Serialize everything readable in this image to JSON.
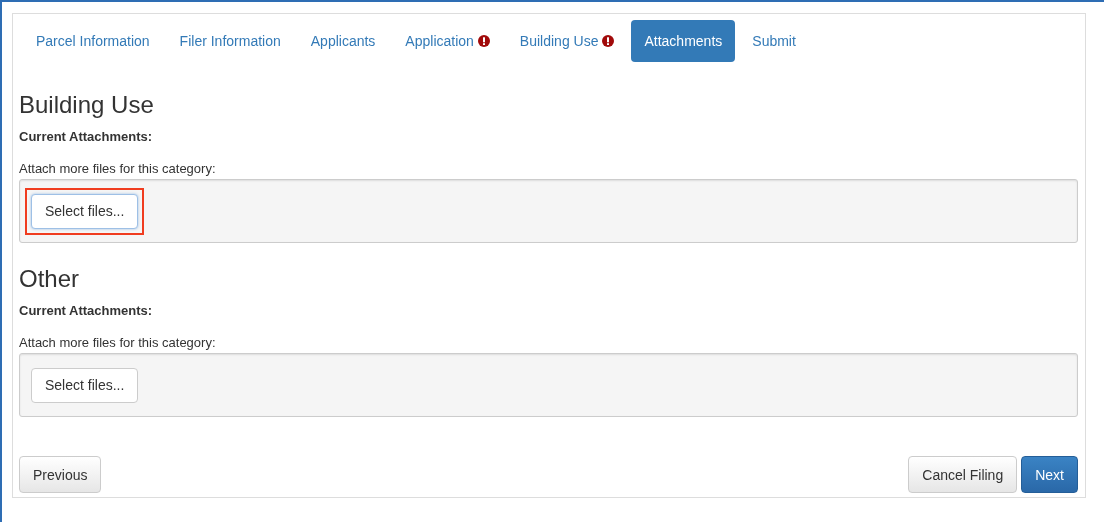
{
  "tabs": [
    {
      "label": "Parcel Information",
      "selected": false,
      "alert": false
    },
    {
      "label": "Filer Information",
      "selected": false,
      "alert": false
    },
    {
      "label": "Applicants",
      "selected": false,
      "alert": false
    },
    {
      "label": "Application",
      "selected": false,
      "alert": true
    },
    {
      "label": "Building Use",
      "selected": false,
      "alert": true
    },
    {
      "label": "Attachments",
      "selected": true,
      "alert": false
    },
    {
      "label": "Submit",
      "selected": false,
      "alert": false
    }
  ],
  "sections": [
    {
      "title": "Building Use",
      "current_label": "Current Attachments:",
      "attach_label": "Attach more files for this category:",
      "button": "Select files...",
      "highlighted": true
    },
    {
      "title": "Other",
      "current_label": "Current Attachments:",
      "attach_label": "Attach more files for this category:",
      "button": "Select files...",
      "highlighted": false
    }
  ],
  "footer": {
    "left": [
      {
        "label": "Previous"
      }
    ],
    "right": [
      {
        "label": "Cancel Filing",
        "kind": "default"
      },
      {
        "label": "Next",
        "kind": "primary"
      }
    ]
  }
}
